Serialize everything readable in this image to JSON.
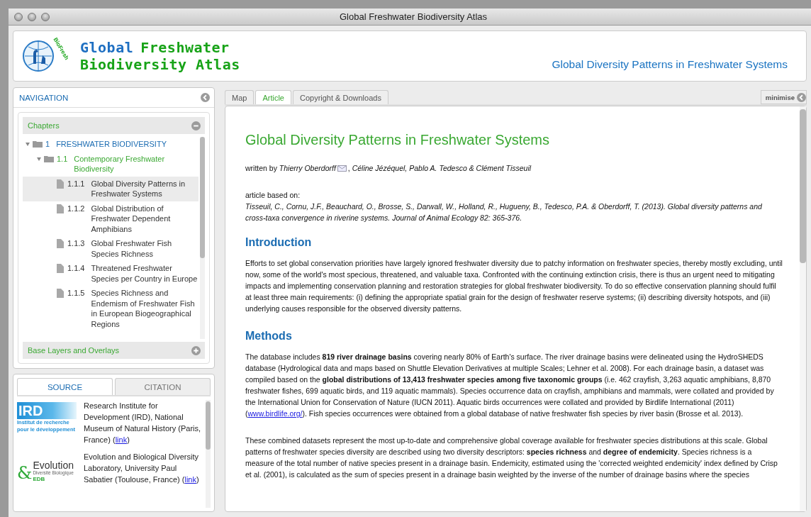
{
  "window": {
    "title": "Global Freshwater Biodiversity Atlas"
  },
  "header": {
    "logo": {
      "badge": "BioFresh",
      "lines": [
        [
          {
            "text": "Global",
            "color": "#1e6fc2"
          },
          {
            "text": "Freshwater",
            "color": "#17a317"
          }
        ],
        [
          {
            "text": "Biodiversity Atlas",
            "color": "#17a317"
          }
        ]
      ]
    },
    "page_title": "Global Diversity Patterns in Freshwater Systems"
  },
  "navigation": {
    "title": "NAVIGATION",
    "sections": [
      {
        "title": "Chapters",
        "expanded": true
      },
      {
        "title": "Base Layers and Overlays",
        "expanded": false
      }
    ],
    "tree": [
      {
        "kind": "chapter",
        "number": "1",
        "title": "FRESHWATER BIODIVERSITY",
        "expanded": true,
        "selected": false,
        "children": [
          {
            "kind": "section",
            "number": "1.1",
            "title": "Contemporary Freshwater Biodiversity",
            "expanded": true,
            "selected": false,
            "children": [
              {
                "kind": "page",
                "number": "1.1.1",
                "title": "Global Diversity Patterns in Freshwater Systems",
                "selected": true
              },
              {
                "kind": "page",
                "number": "1.1.2",
                "title": "Global Distribution of Freshwater Dependent Amphibians",
                "selected": false
              },
              {
                "kind": "page",
                "number": "1.1.3",
                "title": "Global Freshwater Fish Species Richness",
                "selected": false
              },
              {
                "kind": "page",
                "number": "1.1.4",
                "title": "Threatened Freshwater Species per Country in Europe",
                "selected": false
              },
              {
                "kind": "page",
                "number": "1.1.5",
                "title": "Species Richness and Endemism of Freshwater Fish in European Biogeographical Regions",
                "selected": false
              }
            ]
          }
        ]
      }
    ]
  },
  "source_panel": {
    "tabs": [
      {
        "label": "SOURCE",
        "selected": true
      },
      {
        "label": "CITATION",
        "selected": false
      }
    ],
    "items": [
      {
        "logo": {
          "kind": "ird",
          "lines": [
            "IRD",
            "Institut de recherche",
            "pour le développement"
          ]
        },
        "text": "Research Institute for Development (IRD), National Museum of Natural History (Paris, France) (",
        "link": "link",
        "after": ")"
      },
      {
        "logo": {
          "kind": "evolution",
          "lines": [
            "&",
            "Evolution",
            "Diversité Biologique",
            "EDB"
          ]
        },
        "text": "Evolution and Biological Diversity Laboratory, University Paul Sabatier (Toulouse, France) (",
        "link": "link",
        "after": ")"
      }
    ]
  },
  "content": {
    "tabs": [
      {
        "label": "Map",
        "selected": false
      },
      {
        "label": "Article",
        "selected": true
      },
      {
        "label": "Copyright & Downloads",
        "selected": false
      }
    ],
    "minimise": "minimise",
    "article": {
      "title": "Global Diversity Patterns in Freshwater Systems",
      "byline": "written by *Thierry Oberdorff*",
      "byline_rest": ", *Céline Jézéquel, Pablo A. Tedesco & Clément Tisseuil*",
      "based_on": "article based on:",
      "citation": "Tisseuil, C., Cornu, J.F., Beauchard, O., Brosse, S., Darwall, W., Holland, R., Hugueny, B., Tedesco, P.A. & Oberdorff, T. (2013). Global diversity patterns and cross-taxa convergence in riverine systems. Journal of Animal Ecology 82: 365-376.",
      "sections": [
        {
          "heading": "Introduction",
          "paragraphs": [
            {
              "text": "Efforts to set global conservation priorities have largely ignored freshwater diversity due to patchy information on freshwater species, thereby mostly excluding, until now, some of the world's most specious, threatened, and valuable taxa. Confronted with the continuing extinction crisis, there is thus an urgent need to mitigating impacts and implementing conservation planning and restoration strategies for global freshwater biodiversity. To do so effective conservation planning should fulfil at least three main requirements: (i) defining the appropriate spatial grain for the design of freshwater reserve systems; (ii) describing diversity hotspots, and (iii) underlying causes responsible for the observed diversity patterns."
            }
          ]
        },
        {
          "heading": "Methods",
          "paragraphs": [
            {
              "text": "The database includes **819 river drainage basins** covering nearly 80% of Earth's surface. The river drainage basins were delineated using the HydroSHEDS database (Hydrological data and maps based on Shuttle Elevation Derivatives at multiple Scales; Lehner et al. 2008). For each drainage basin, a dataset was compiled based on the **global distributions of 13,413 freshwater species among five taxonomic groups** (i.e. 462 crayfish, 3,263 aquatic amphibians, 8,870 freshwater fishes, 699 aquatic birds, and 119 aquatic mammals). Species occurrence data on crayfish, amphibians and mammals, were collated and provided by the International Union for Conservation of Nature (IUCN 2011). Aquatic birds occurrences were collated and provided by Birdlife International (2011) (",
              "link": "www.birdlife.org/",
              "after": "). Fish species occurrences were obtained from a global database of native freshwater fish species by river basin (Brosse et al. 2013)."
            },
            {
              "text": "These combined datasets represent the most up-to-date and comprehensive global coverage available for freshwater species distributions at this scale. Global patterns of freshwater species diversity are described using two diversity descriptors: **species richness** and **degree of endemicity**. Species richness is a measure of the total number of native species present in a drainage basin. Endemicity, estimated using the 'corrected weighted endemicity' index defined by Crisp et al. (2001), is calculated as the sum of species present in a drainage basin weighted by the inverse of the number of drainage basins where the species"
            }
          ]
        }
      ]
    }
  }
}
